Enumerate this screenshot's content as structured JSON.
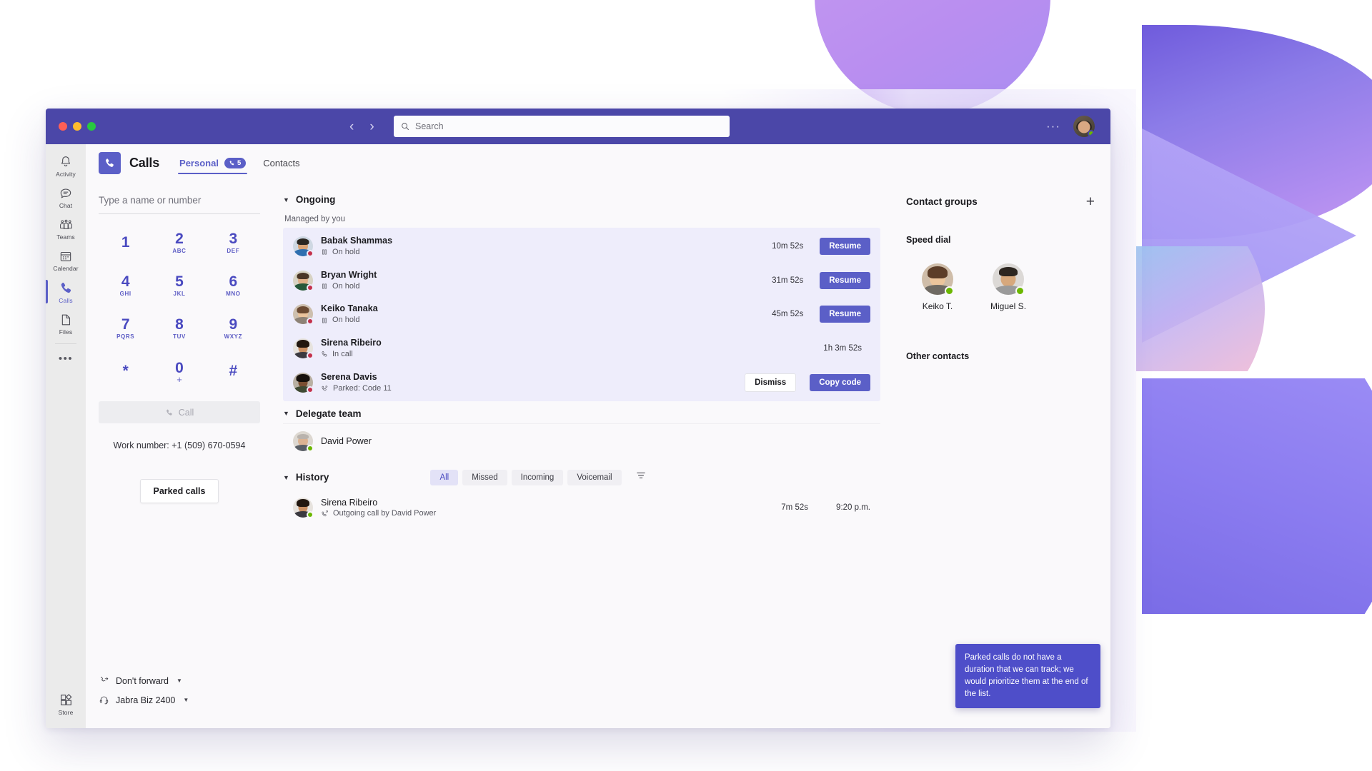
{
  "titlebar": {
    "search_placeholder": "Search",
    "back_icon": "chevron-left-icon",
    "forward_icon": "chevron-right-icon",
    "more_label": "···"
  },
  "rail": {
    "items": [
      {
        "label": "Activity",
        "icon": "bell-icon"
      },
      {
        "label": "Chat",
        "icon": "chat-icon"
      },
      {
        "label": "Teams",
        "icon": "teams-icon"
      },
      {
        "label": "Calendar",
        "icon": "calendar-icon"
      },
      {
        "label": "Calls",
        "icon": "phone-icon",
        "active": true
      },
      {
        "label": "Files",
        "icon": "file-icon"
      }
    ],
    "more_label": "•••",
    "store": {
      "label": "Store",
      "icon": "store-icon"
    }
  },
  "apphead": {
    "title": "Calls",
    "icon": "phone-icon",
    "tabs": [
      {
        "label": "Personal",
        "active": true,
        "badge": "5",
        "badge_icon": "phone-icon"
      },
      {
        "label": "Contacts",
        "active": false
      }
    ]
  },
  "dialpad": {
    "input_placeholder": "Type a name or number",
    "keys": [
      {
        "num": "1",
        "sub": ""
      },
      {
        "num": "2",
        "sub": "ABC"
      },
      {
        "num": "3",
        "sub": "DEF"
      },
      {
        "num": "4",
        "sub": "GHI"
      },
      {
        "num": "5",
        "sub": "JKL"
      },
      {
        "num": "6",
        "sub": "MNO"
      },
      {
        "num": "7",
        "sub": "PQRS"
      },
      {
        "num": "8",
        "sub": "TUV"
      },
      {
        "num": "9",
        "sub": "WXYZ"
      },
      {
        "num": "*",
        "sub": ""
      },
      {
        "num": "0",
        "sub": "+"
      },
      {
        "num": "#",
        "sub": ""
      }
    ],
    "call_label": "Call",
    "work_number_label": "Work number: +1 (509) 670-0594",
    "parked_calls_label": "Parked calls",
    "forward": {
      "label": "Don't forward",
      "icon": "call-forward-icon"
    },
    "device": {
      "label": "Jabra Biz 2400",
      "icon": "headset-icon"
    }
  },
  "ongoing": {
    "title": "Ongoing",
    "managed_by_label": "Managed by you",
    "rows": [
      {
        "name": "Babak Shammas",
        "status": "On hold",
        "status_icon": "pause-icon",
        "duration": "10m 52s",
        "action": "Resume",
        "presence": "busy",
        "skin": "#d9a477",
        "hair": "#2b2722",
        "shirt": "#2f6fb0",
        "bg": "#cfd8e3"
      },
      {
        "name": "Bryan Wright",
        "status": "On hold",
        "status_icon": "pause-icon",
        "duration": "31m 52s",
        "action": "Resume",
        "presence": "busy",
        "skin": "#e0b089",
        "hair": "#4a3526",
        "shirt": "#27583a",
        "bg": "#d8d3c4"
      },
      {
        "name": "Keiko Tanaka",
        "status": "On hold",
        "status_icon": "pause-icon",
        "duration": "45m 52s",
        "action": "Resume",
        "presence": "busy",
        "skin": "#e9c39c",
        "hair": "#6b4a32",
        "shirt": "#8d8276",
        "bg": "#cdbfae"
      },
      {
        "name": "Sirena Ribeiro",
        "status": "In call",
        "status_icon": "phone-icon",
        "duration": "1h 3m 52s",
        "action": "",
        "presence": "busy",
        "skin": "#c98f63",
        "hair": "#22170f",
        "shirt": "#3b3a40",
        "bg": "#e7e3de"
      },
      {
        "name": "Serena Davis",
        "status": "Parked: Code 11",
        "status_icon": "park-icon",
        "duration": "",
        "action": "Copy code",
        "secondary_action": "Dismiss",
        "presence": "busy",
        "skin": "#7a4f32",
        "hair": "#17110c",
        "shirt": "#3f4a33",
        "bg": "#b9b0a3"
      }
    ]
  },
  "delegate": {
    "title": "Delegate team",
    "members": [
      {
        "name": "David Power",
        "presence": "avail",
        "skin": "#dcb392",
        "hair": "#b9b3ad",
        "shirt": "#5a5f66",
        "bg": "#ddd8d1"
      }
    ]
  },
  "history": {
    "title": "History",
    "filters": [
      {
        "label": "All",
        "active": true
      },
      {
        "label": "Missed",
        "active": false
      },
      {
        "label": "Incoming",
        "active": false
      },
      {
        "label": "Voicemail",
        "active": false
      }
    ],
    "filter_icon": "filter-icon",
    "rows": [
      {
        "name": "Sirena Ribeiro",
        "detail": "Outgoing call by David Power",
        "detail_icon": "outgoing-call-icon",
        "duration": "7m 52s",
        "time": "9:20 p.m.",
        "presence": "avail",
        "skin": "#c98f63",
        "hair": "#22170f",
        "shirt": "#3b3a40",
        "bg": "#e7e3de"
      }
    ]
  },
  "contacts_panel": {
    "title": "Contact groups",
    "add_icon": "plus-icon",
    "speed_dial_label": "Speed dial",
    "speed_dial": [
      {
        "name": "Keiko T.",
        "presence": "avail",
        "skin": "#ecc59c",
        "hair": "#5c3d28",
        "shirt": "#6f6a63",
        "bg": "#cfbda9"
      },
      {
        "name": "Miguel S.",
        "presence": "avail",
        "skin": "#d7a87c",
        "hair": "#2d2620",
        "shirt": "#9a9a9a",
        "bg": "#dcd9d6"
      }
    ],
    "other_contacts_label": "Other contacts"
  },
  "annotation": {
    "text": "Parked calls do not have a duration that we can track; we would prioritize them at the end of the list."
  },
  "colors": {
    "brand": "#5b5fc7",
    "titlebar": "#4b47a8",
    "busy": "#c4314b",
    "available": "#6bb700",
    "card": "#eeedfb"
  }
}
